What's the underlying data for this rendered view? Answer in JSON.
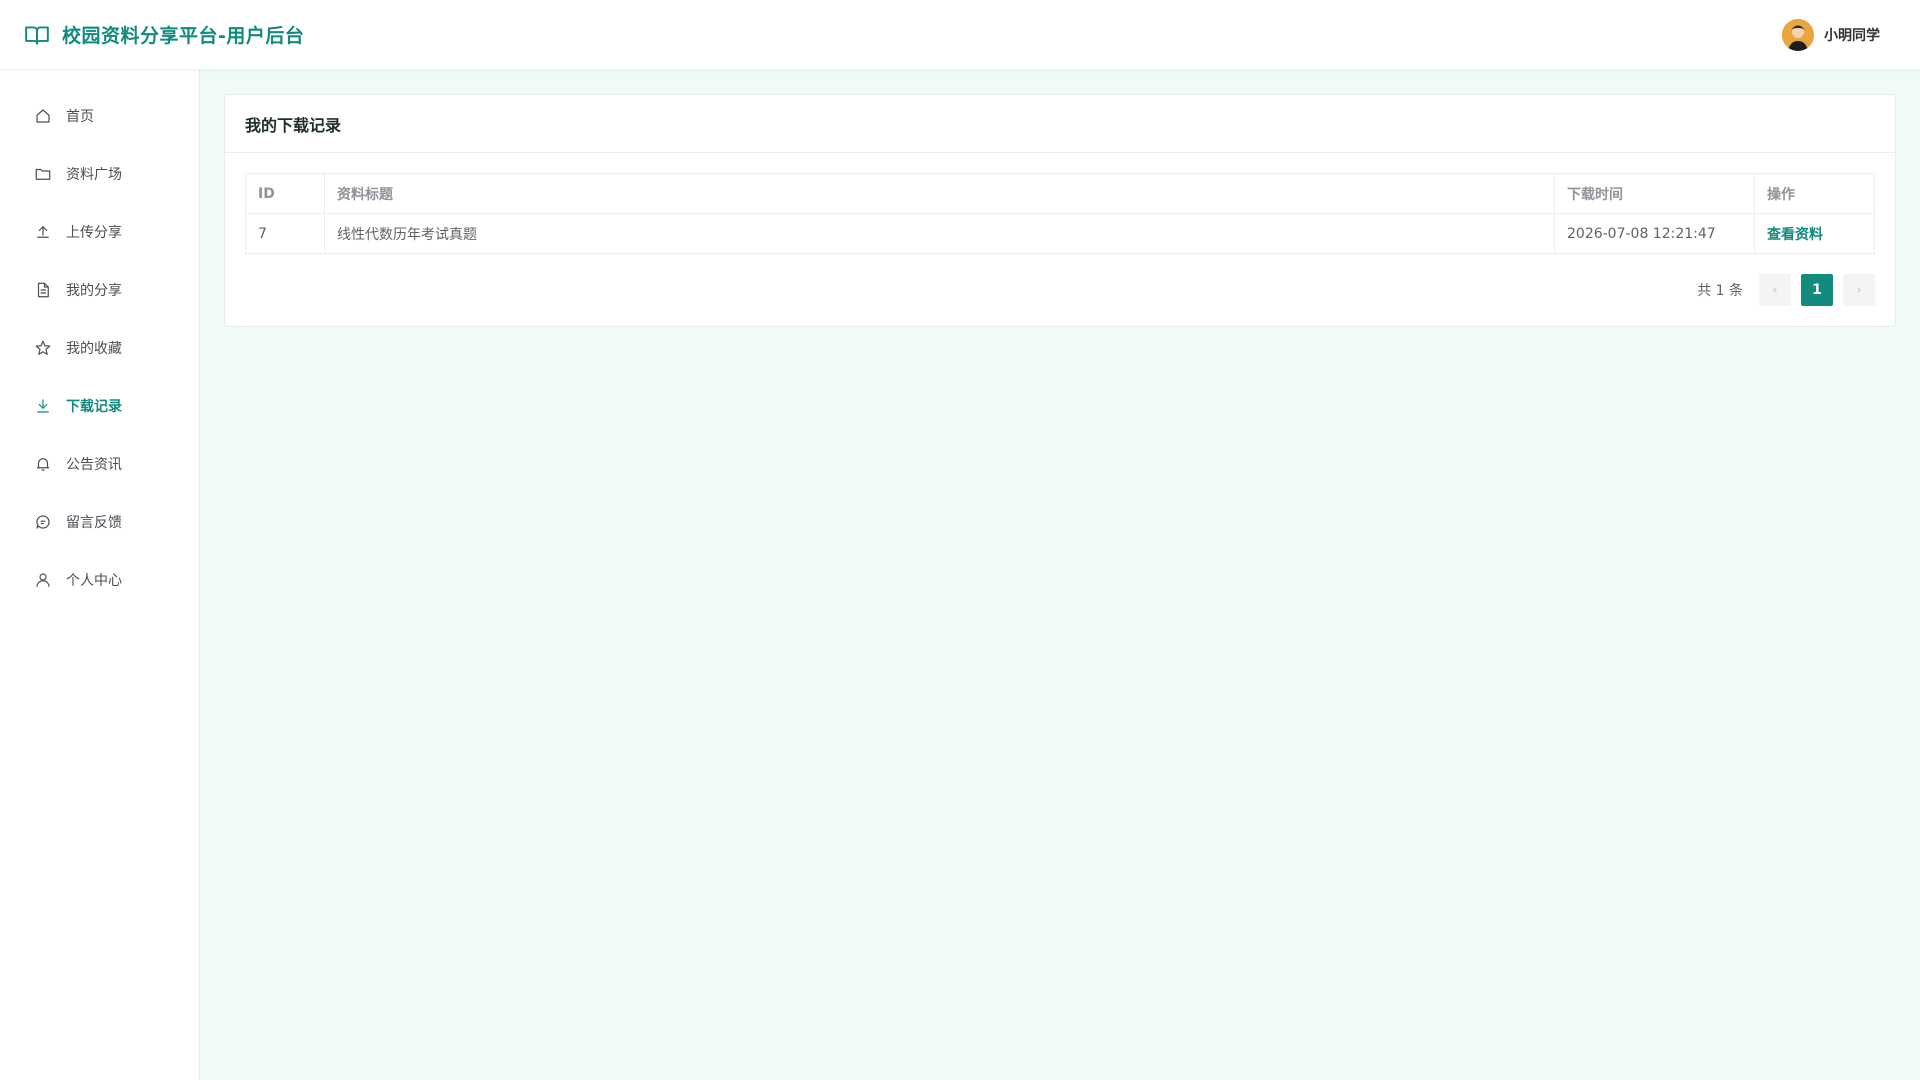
{
  "header": {
    "title": "校园资料分享平台-用户后台",
    "brand_icon": "book-open-icon",
    "user_name": "小明同学"
  },
  "sidebar": {
    "items": [
      {
        "label": "首页",
        "icon": "home-icon"
      },
      {
        "label": "资料广场",
        "icon": "folder-icon"
      },
      {
        "label": "上传分享",
        "icon": "upload-icon"
      },
      {
        "label": "我的分享",
        "icon": "document-icon"
      },
      {
        "label": "我的收藏",
        "icon": "star-icon"
      },
      {
        "label": "下载记录",
        "icon": "download-icon",
        "active": true
      },
      {
        "label": "公告资讯",
        "icon": "bell-icon"
      },
      {
        "label": "留言反馈",
        "icon": "chat-icon"
      },
      {
        "label": "个人中心",
        "icon": "user-icon"
      }
    ]
  },
  "main": {
    "card_title": "我的下载记录",
    "table": {
      "headers": [
        "ID",
        "资料标题",
        "下载时间",
        "操作"
      ],
      "rows": [
        {
          "id": "7",
          "title": "线性代数历年考试真题",
          "time": "2026-07-08 12:21:47",
          "action": "查看资料"
        }
      ]
    },
    "pagination": {
      "total_text": "共 1 条",
      "current_page": "1",
      "prev": "‹",
      "next": "›"
    }
  },
  "colors": {
    "accent": "#138a7e",
    "background": "#f0fbf9"
  }
}
